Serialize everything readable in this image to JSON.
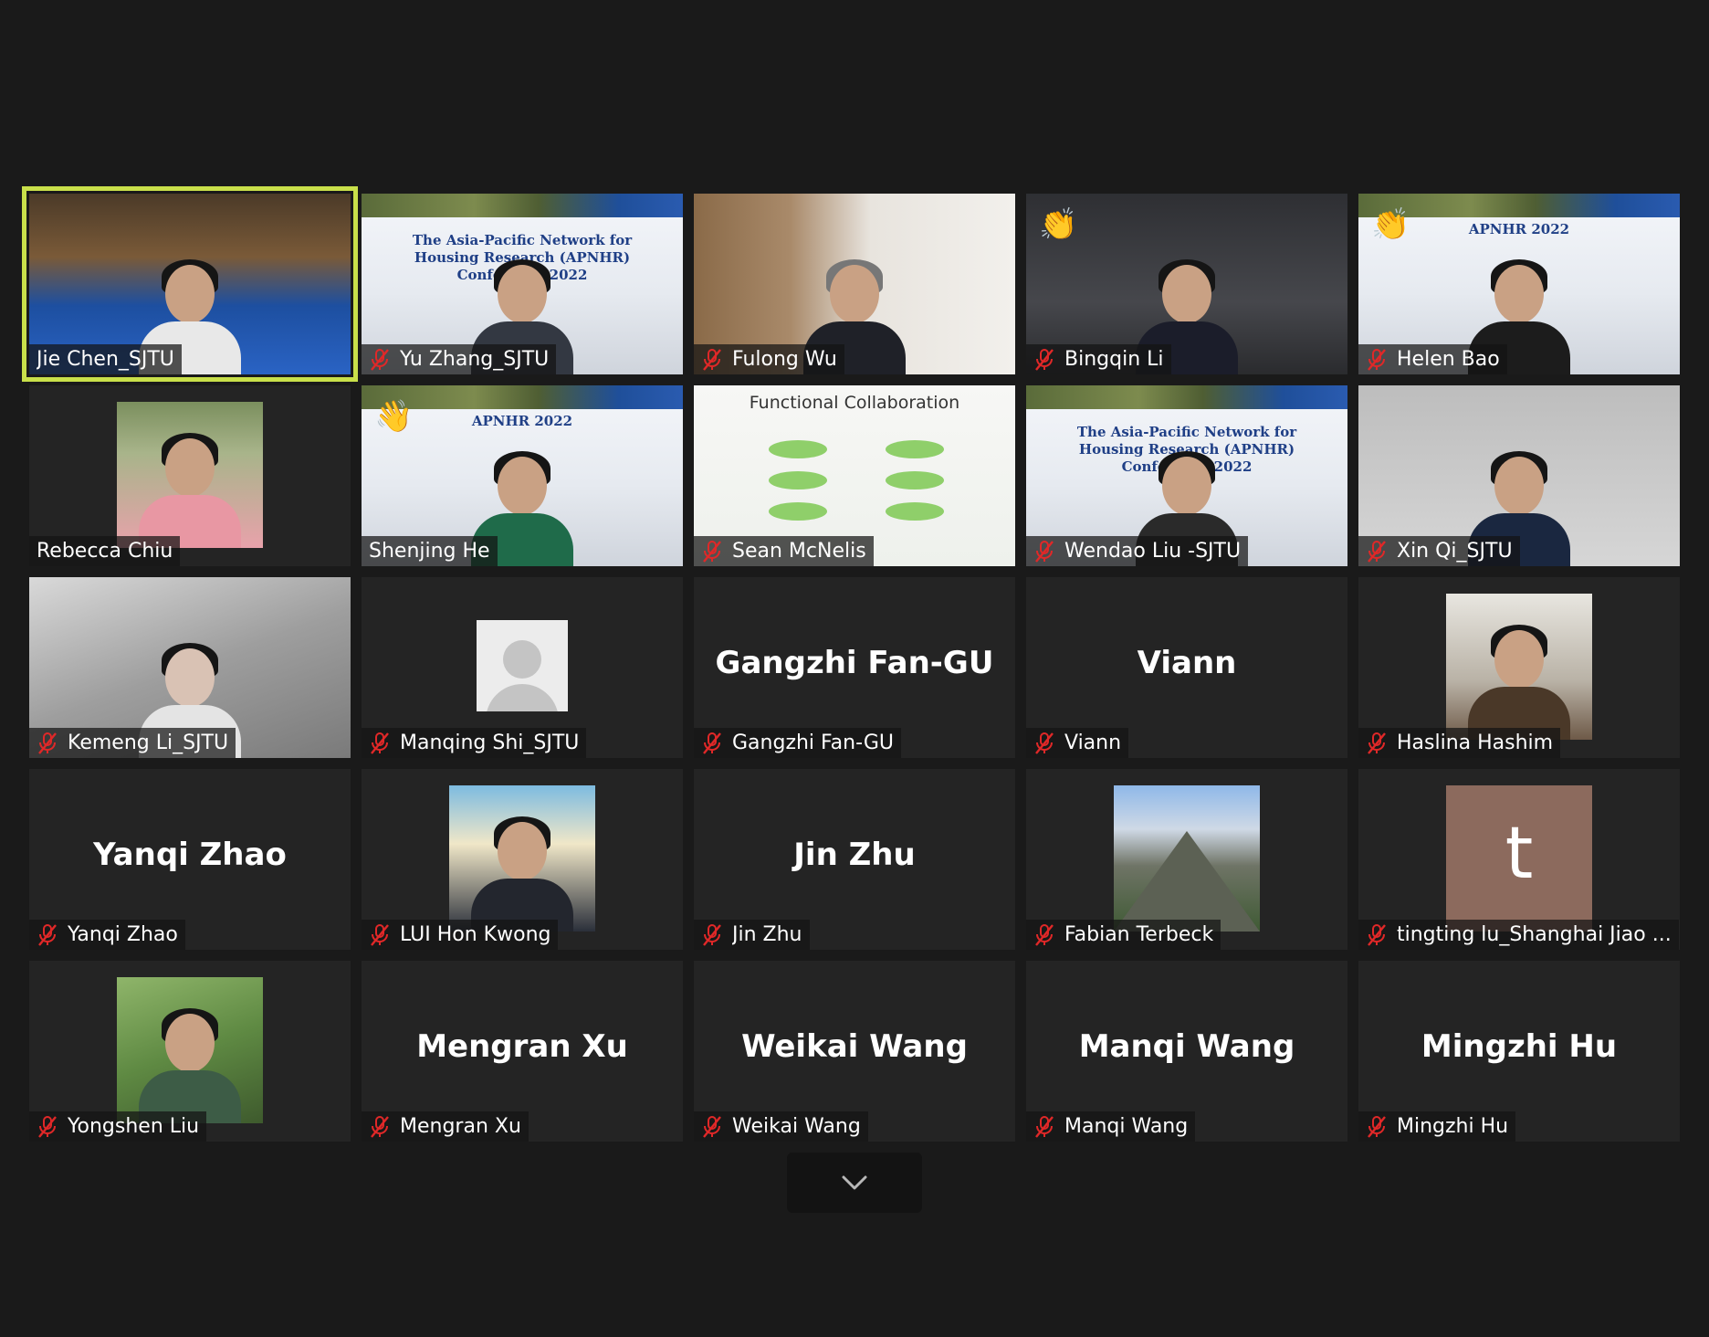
{
  "participants": [
    {
      "name": "Jie Chen_SJTU",
      "muted": false,
      "active": true,
      "video": "campus"
    },
    {
      "name": "Yu Zhang_SJTU",
      "muted": true,
      "video": "slide",
      "slide_text": "The Asia-Pacific Network for Housing Research (APNHR) Conference 2022"
    },
    {
      "name": "Fulong Wu",
      "muted": true,
      "video": "office"
    },
    {
      "name": "Bingqin Li",
      "muted": true,
      "video": "dark",
      "reaction": "👏"
    },
    {
      "name": "Helen Bao",
      "muted": true,
      "video": "slide",
      "slide_text": "APNHR 2022",
      "reaction": "👏"
    },
    {
      "name": "Rebecca Chiu",
      "muted": false,
      "video": "photo-woman"
    },
    {
      "name": "Shenjing He",
      "muted": false,
      "video": "slide",
      "slide_text": "APNHR 2022",
      "reaction": "👋"
    },
    {
      "name": "Sean McNelis",
      "muted": true,
      "video": "collab",
      "slide_text": "Functional Collaboration"
    },
    {
      "name": "Wendao Liu -SJTU",
      "muted": true,
      "video": "slide",
      "slide_text": "The Asia-Pacific Network for Housing Research (APNHR) Conference 2022"
    },
    {
      "name": "Xin Qi_SJTU",
      "muted": true,
      "video": "grey"
    },
    {
      "name": "Kemeng Li_SJTU",
      "muted": true,
      "video": "blur"
    },
    {
      "name": "Manqing Shi_SJTU",
      "muted": true,
      "video": "avatar"
    },
    {
      "name": "Gangzhi Fan-GU",
      "muted": true,
      "video": "name",
      "display_name": "Gangzhi Fan-GU"
    },
    {
      "name": "Viann",
      "muted": true,
      "video": "name",
      "display_name": "Viann"
    },
    {
      "name": "Haslina Hashim",
      "muted": true,
      "video": "photo-haslina"
    },
    {
      "name": "Yanqi Zhao",
      "muted": true,
      "video": "name",
      "display_name": "Yanqi Zhao"
    },
    {
      "name": "LUI Hon Kwong",
      "muted": true,
      "video": "photo-lui"
    },
    {
      "name": "Jin Zhu",
      "muted": true,
      "video": "name",
      "display_name": "Jin Zhu"
    },
    {
      "name": "Fabian Terbeck",
      "muted": true,
      "video": "photo-mountain"
    },
    {
      "name": "tingting lu_Shanghai Jiao ...",
      "muted": true,
      "video": "letter",
      "letter": "t"
    },
    {
      "name": "Yongshen Liu",
      "muted": true,
      "video": "photo-yongshen"
    },
    {
      "name": "Mengran Xu",
      "muted": true,
      "video": "name",
      "display_name": "Mengran Xu"
    },
    {
      "name": "Weikai Wang",
      "muted": true,
      "video": "name",
      "display_name": "Weikai Wang"
    },
    {
      "name": "Manqi Wang",
      "muted": true,
      "video": "name",
      "display_name": "Manqi Wang"
    },
    {
      "name": "Mingzhi Hu",
      "muted": true,
      "video": "name",
      "display_name": "Mingzhi Hu"
    }
  ],
  "colors": {
    "background": "#1a1a1a",
    "tile": "#242424",
    "active_border": "#c9e04a",
    "mute_icon": "#e02828"
  },
  "icons": {
    "mute": "microphone-muted-icon",
    "more": "chevron-down-icon"
  }
}
